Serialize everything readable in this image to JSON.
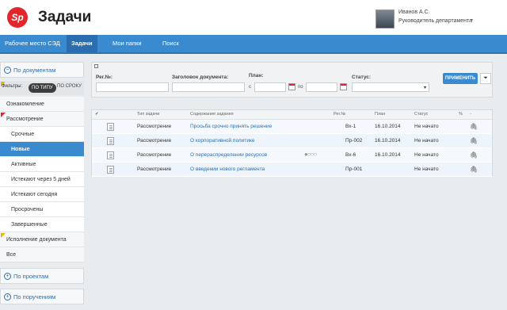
{
  "header": {
    "logo_text": "Sp",
    "title": "Задачи",
    "user_name": "Иванов А.С.",
    "user_role": "Руководитель департамента",
    "caret": "▾"
  },
  "nav": {
    "items": [
      "Рабочее место СЭД",
      "Задачи",
      "Мои папки",
      "Поиск"
    ],
    "active_index": 1
  },
  "sidebar": {
    "sections": {
      "by_documents": "По документам",
      "by_projects": "По проектам",
      "by_assignments": "По поручениям"
    },
    "section_icons": {
      "open": "−",
      "closed": "+"
    },
    "filter_label": "Фильтры:",
    "filter_by_type": "ПО ТИПУ",
    "filter_by_deadline": "ПО СРОКУ",
    "items": [
      "Ознакомление",
      "Рассмотрение",
      "Срочные",
      "Новые",
      "Активные",
      "Истекают через 5 дней",
      "Истекают сегодня",
      "Просрочены",
      "Завершенные",
      "Исполнение документа",
      "Все"
    ],
    "active_item": "Новые"
  },
  "filters": {
    "reg_no_label": "Рег.№:",
    "title_label": "Заголовок документа:",
    "plan_label": "План:",
    "from_label": "с",
    "to_label": "по",
    "status_label": "Статус:",
    "apply_label": "ПРИМЕНИТЬ",
    "select_caret": "▾",
    "funnel_icon": "⏷"
  },
  "table": {
    "headers": {
      "check": "✔",
      "type": "Тип задачи",
      "content": "Содержание задания",
      "reg": "Рег.№",
      "plan": "План",
      "status": "Статус",
      "percent": "%",
      "dash": "-"
    },
    "rows": [
      {
        "type": "Рассмотрение",
        "content": "Просьба срочно принять решение",
        "reg": "Вх-1",
        "plan": "16.10.2014",
        "status": "Не начато",
        "progress": ""
      },
      {
        "type": "Рассмотрение",
        "content": "О корпоративной политике",
        "reg": "Пр-002",
        "plan": "16.10.2014",
        "status": "Не начато",
        "progress": ""
      },
      {
        "type": "Рассмотрение",
        "content": "О перераспределении ресурсов",
        "reg": "Вх-6",
        "plan": "16.10.2014",
        "status": "Не начато",
        "progress": "●○○○"
      },
      {
        "type": "Рассмотрение",
        "content": "О введении нового регламента",
        "reg": "Пр-001",
        "plan": "",
        "status": "Не начато",
        "progress": ""
      }
    ],
    "clip_icon": "🖇"
  },
  "colors": {
    "brand_red": "#e2262a",
    "nav_blue": "#3a8ad0",
    "link_blue": "#2a6fb5"
  }
}
